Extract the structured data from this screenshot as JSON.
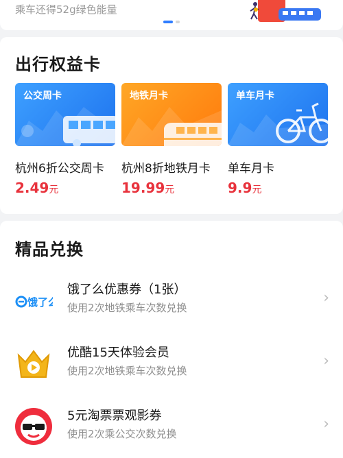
{
  "banner": {
    "subtitle": "乘车还得52g绿色能量",
    "page_indicator": {
      "active": 1,
      "total": 2
    }
  },
  "passes_section": {
    "title": "出行权益卡",
    "cards": [
      {
        "tag": "公交周卡",
        "name": "杭州6折公交周卡",
        "price": "2.49",
        "unit": "元",
        "theme": "blue",
        "icon": "bus-icon"
      },
      {
        "tag": "地铁月卡",
        "name": "杭州8折地铁月卡",
        "price": "19.99",
        "unit": "元",
        "theme": "orange",
        "icon": "metro-train-icon"
      },
      {
        "tag": "单车月卡",
        "name": "单车月卡",
        "price": "9.9",
        "unit": "元",
        "theme": "blue",
        "icon": "bicycle-icon"
      }
    ]
  },
  "redeem_section": {
    "title": "精品兑换",
    "items": [
      {
        "title": "饿了么优惠券（1张）",
        "desc": "使用2次地铁乘车次数兑换",
        "logo": "eleme-logo",
        "logo_text": "饿了么"
      },
      {
        "title": "优酷15天体验会员",
        "desc": "使用2次地铁乘车次数兑换",
        "logo": "youku-crown-logo"
      },
      {
        "title": "5元淘票票观影券",
        "desc": "使用2次乘公交次数兑换",
        "logo": "taopiaopiao-logo"
      }
    ]
  },
  "colors": {
    "accent_blue": "#2f7dff",
    "price_red": "#e8323c",
    "card_blue": "#3ea0ff",
    "card_orange": "#ff8a1a"
  }
}
